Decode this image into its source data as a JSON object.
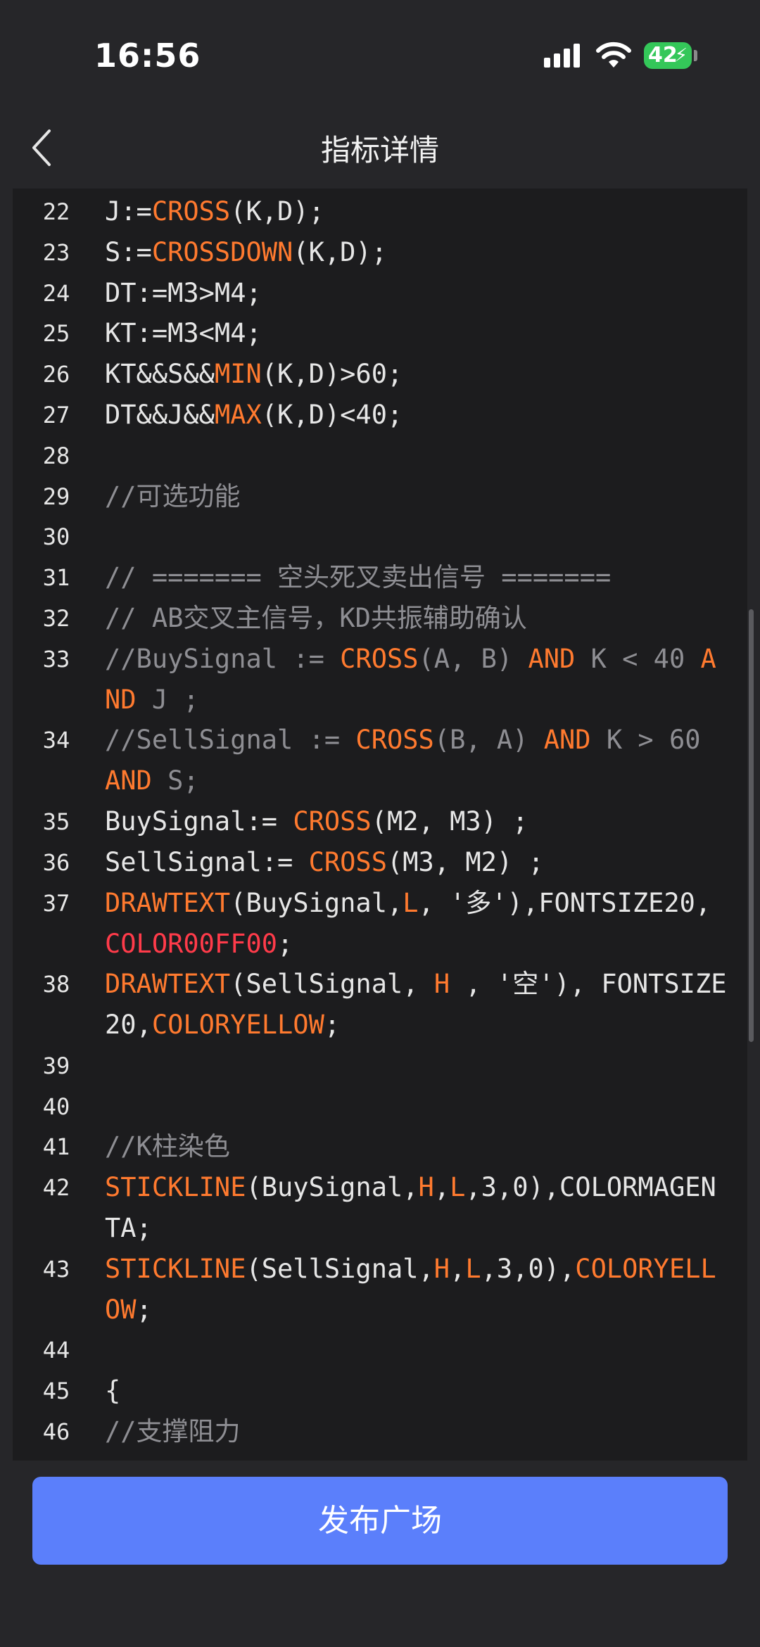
{
  "status_bar": {
    "time": "16:56",
    "battery_level": "42",
    "signal_icon": "cellular-signal-icon",
    "wifi_icon": "wifi-icon",
    "charging_icon": "bolt-icon"
  },
  "nav": {
    "title": "指标详情",
    "back_icon": "chevron-left-icon"
  },
  "colors": {
    "keyword": "#ff7a2f",
    "red_keyword": "#ff3b4a",
    "comment": "#8e8e93",
    "text": "#e6e6e6",
    "button": "#5b7ffb"
  },
  "code_lines": [
    {
      "num": "22",
      "tokens": [
        [
          "t",
          "J:="
        ],
        [
          "k",
          "CROSS"
        ],
        [
          "t",
          "(K,D);"
        ]
      ]
    },
    {
      "num": "23",
      "tokens": [
        [
          "t",
          "S:="
        ],
        [
          "k",
          "CROSSDOWN"
        ],
        [
          "t",
          "(K,D);"
        ]
      ]
    },
    {
      "num": "24",
      "tokens": [
        [
          "t",
          "DT:=M3>M4;"
        ]
      ]
    },
    {
      "num": "25",
      "tokens": [
        [
          "t",
          "KT:=M3<M4;"
        ]
      ]
    },
    {
      "num": "26",
      "tokens": [
        [
          "t",
          "KT&&S&&"
        ],
        [
          "k",
          "MIN"
        ],
        [
          "t",
          "(K,D)>60;"
        ]
      ]
    },
    {
      "num": "27",
      "tokens": [
        [
          "t",
          "DT&&J&&"
        ],
        [
          "k",
          "MAX"
        ],
        [
          "t",
          "(K,D)<40;"
        ]
      ]
    },
    {
      "num": "28",
      "tokens": []
    },
    {
      "num": "29",
      "tokens": [
        [
          "c",
          "//可选功能"
        ]
      ]
    },
    {
      "num": "30",
      "tokens": []
    },
    {
      "num": "31",
      "tokens": [
        [
          "c",
          "// ======= 空头死叉卖出信号 ======="
        ]
      ]
    },
    {
      "num": "32",
      "tokens": [
        [
          "c",
          "// AB交叉主信号，KD共振辅助确认"
        ]
      ]
    },
    {
      "num": "33",
      "tokens": [
        [
          "c",
          "//BuySignal := "
        ],
        [
          "k",
          "CROSS"
        ],
        [
          "c",
          "(A, B) "
        ],
        [
          "k",
          "AND"
        ],
        [
          "c",
          " K < 40 "
        ],
        [
          "k",
          "AND"
        ],
        [
          "c",
          " J ;"
        ]
      ]
    },
    {
      "num": "34",
      "tokens": [
        [
          "c",
          "//SellSignal := "
        ],
        [
          "k",
          "CROSS"
        ],
        [
          "c",
          "(B, A) "
        ],
        [
          "k",
          "AND"
        ],
        [
          "c",
          " K > 60 "
        ],
        [
          "k",
          "AND"
        ],
        [
          "c",
          " S;"
        ]
      ]
    },
    {
      "num": "35",
      "tokens": [
        [
          "t",
          "BuySignal:= "
        ],
        [
          "k",
          "CROSS"
        ],
        [
          "t",
          "(M2, M3) ;"
        ]
      ]
    },
    {
      "num": "36",
      "tokens": [
        [
          "t",
          "SellSignal:= "
        ],
        [
          "k",
          "CROSS"
        ],
        [
          "t",
          "(M3, M2) ;"
        ]
      ]
    },
    {
      "num": "37",
      "tokens": [
        [
          "k",
          "DRAWTEXT"
        ],
        [
          "t",
          "(BuySignal,"
        ],
        [
          "k",
          "L"
        ],
        [
          "t",
          ", '多'),FONTSIZE20, "
        ],
        [
          "r",
          "COLOR00FF00"
        ],
        [
          "t",
          ";"
        ]
      ]
    },
    {
      "num": "38",
      "tokens": [
        [
          "k",
          "DRAWTEXT"
        ],
        [
          "t",
          "(SellSignal, "
        ],
        [
          "k",
          "H"
        ],
        [
          "t",
          " , '空'), FONTSIZE20,"
        ],
        [
          "k",
          "COLORYELLOW"
        ],
        [
          "t",
          ";"
        ]
      ]
    },
    {
      "num": "39",
      "tokens": []
    },
    {
      "num": "40",
      "tokens": []
    },
    {
      "num": "41",
      "tokens": [
        [
          "c",
          "//K柱染色"
        ]
      ]
    },
    {
      "num": "42",
      "tokens": [
        [
          "k",
          "STICKLINE"
        ],
        [
          "t",
          "(BuySignal,"
        ],
        [
          "k",
          "H"
        ],
        [
          "t",
          ","
        ],
        [
          "k",
          "L"
        ],
        [
          "t",
          ",3,0),COLORMAGENTA;"
        ]
      ]
    },
    {
      "num": "43",
      "tokens": [
        [
          "k",
          "STICKLINE"
        ],
        [
          "t",
          "(SellSignal,"
        ],
        [
          "k",
          "H"
        ],
        [
          "t",
          ","
        ],
        [
          "k",
          "L"
        ],
        [
          "t",
          ",3,0),"
        ],
        [
          "k",
          "COLORYELLOW"
        ],
        [
          "t",
          ";"
        ]
      ]
    },
    {
      "num": "44",
      "tokens": []
    },
    {
      "num": "45",
      "tokens": [
        [
          "t",
          "{"
        ]
      ]
    },
    {
      "num": "46",
      "tokens": [
        [
          "c",
          "//支撑阻力"
        ]
      ]
    }
  ],
  "footer": {
    "publish_label": "发布广场"
  }
}
